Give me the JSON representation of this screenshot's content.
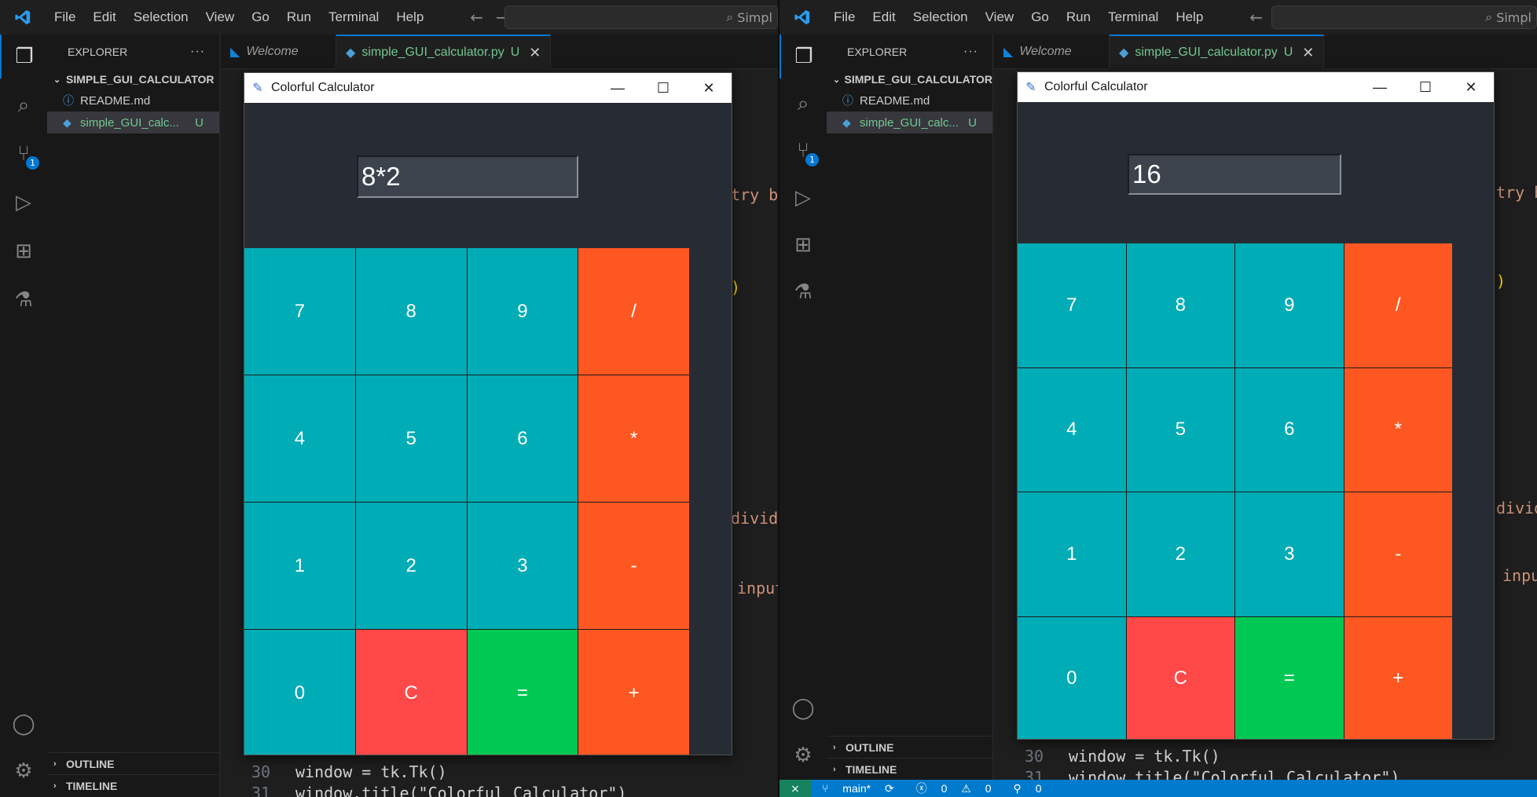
{
  "menu": [
    "File",
    "Edit",
    "Selection",
    "View",
    "Go",
    "Run",
    "Terminal",
    "Help"
  ],
  "command_center": "Simpl",
  "explorer": {
    "title": "EXPLORER",
    "folder": "SIMPLE_GUI_CALCULATOR",
    "files": [
      {
        "name": "README.md"
      },
      {
        "name": "simple_GUI_calc...",
        "status": "U"
      }
    ],
    "outline": "OUTLINE",
    "timeline": "TIMELINE"
  },
  "source_control_badge": "1",
  "tabs": {
    "welcome": "Welcome",
    "active": "simple_GUI_calculator.py",
    "active_status": "U"
  },
  "code": {
    "frag_entry": "try bo",
    "frag_divide": "divide",
    "frag_input": "input",
    "line30_no": "30",
    "line30_text": "window = tk.Tk()",
    "line31_no": "31",
    "line31_text": "window.title(\"Colorful Calculator\")"
  },
  "calculator": {
    "title": "Colorful Calculator",
    "keys": [
      "7",
      "8",
      "9",
      "/",
      "4",
      "5",
      "6",
      "*",
      "1",
      "2",
      "3",
      "-",
      "0",
      "C",
      "=",
      "+"
    ]
  },
  "left_display": "8*2",
  "right_display": "16",
  "statusbar": {
    "branch": "main*",
    "errors": "0",
    "warnings": "0",
    "ports": "0"
  },
  "colors": {
    "number_key": "#00acb5",
    "operator_key": "#ff5722",
    "clear_key": "#ff4848",
    "equals_key": "#00c853",
    "calc_background": "#272c34",
    "status_bar": "#007acc"
  }
}
